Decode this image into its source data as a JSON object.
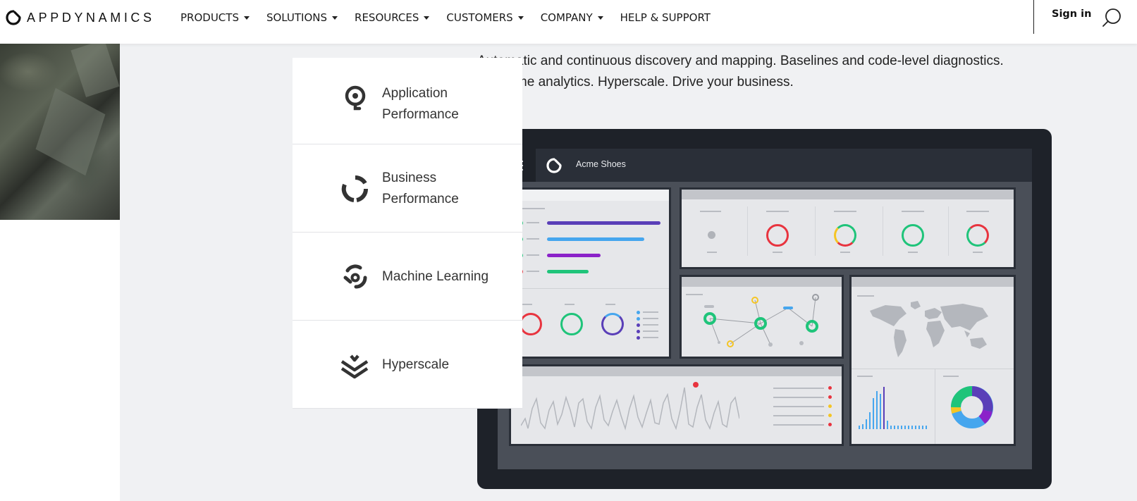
{
  "brand": {
    "name": "APPDYNAMICS"
  },
  "nav": {
    "items": [
      {
        "label": "PRODUCTS",
        "has_caret": true
      },
      {
        "label": "SOLUTIONS",
        "has_caret": true
      },
      {
        "label": "RESOURCES",
        "has_caret": true
      },
      {
        "label": "CUSTOMERS",
        "has_caret": true
      },
      {
        "label": "COMPANY",
        "has_caret": true
      },
      {
        "label": "HELP & SUPPORT",
        "has_caret": false
      }
    ],
    "signin_label": "Sign in",
    "search_icon": "search-icon"
  },
  "features": [
    {
      "line1": "Application",
      "line2": "Performance",
      "icon": "magnifier-icon"
    },
    {
      "line1": "Business",
      "line2": "Performance",
      "icon": "segmented-ring-icon"
    },
    {
      "line1": "Machine Learning",
      "line2": "",
      "icon": "machine-learning-icon"
    },
    {
      "line1": "Hyperscale",
      "line2": "",
      "icon": "layered-chevron-icon"
    }
  ],
  "description": {
    "line1": "Automatic and continuous discovery and mapping. Baselines and code-level diagnostics.",
    "line2": "Real-time analytics. Hyperscale. Drive your business."
  },
  "mockup": {
    "app_title": "Acme Shoes",
    "colors": {
      "frame": "#1e2229",
      "red": "#e8343f",
      "green": "#1fc47a",
      "blue": "#46a6ee",
      "indigo": "#5a3fb8",
      "purple": "#8b22c9",
      "yellow": "#f5c524"
    }
  }
}
